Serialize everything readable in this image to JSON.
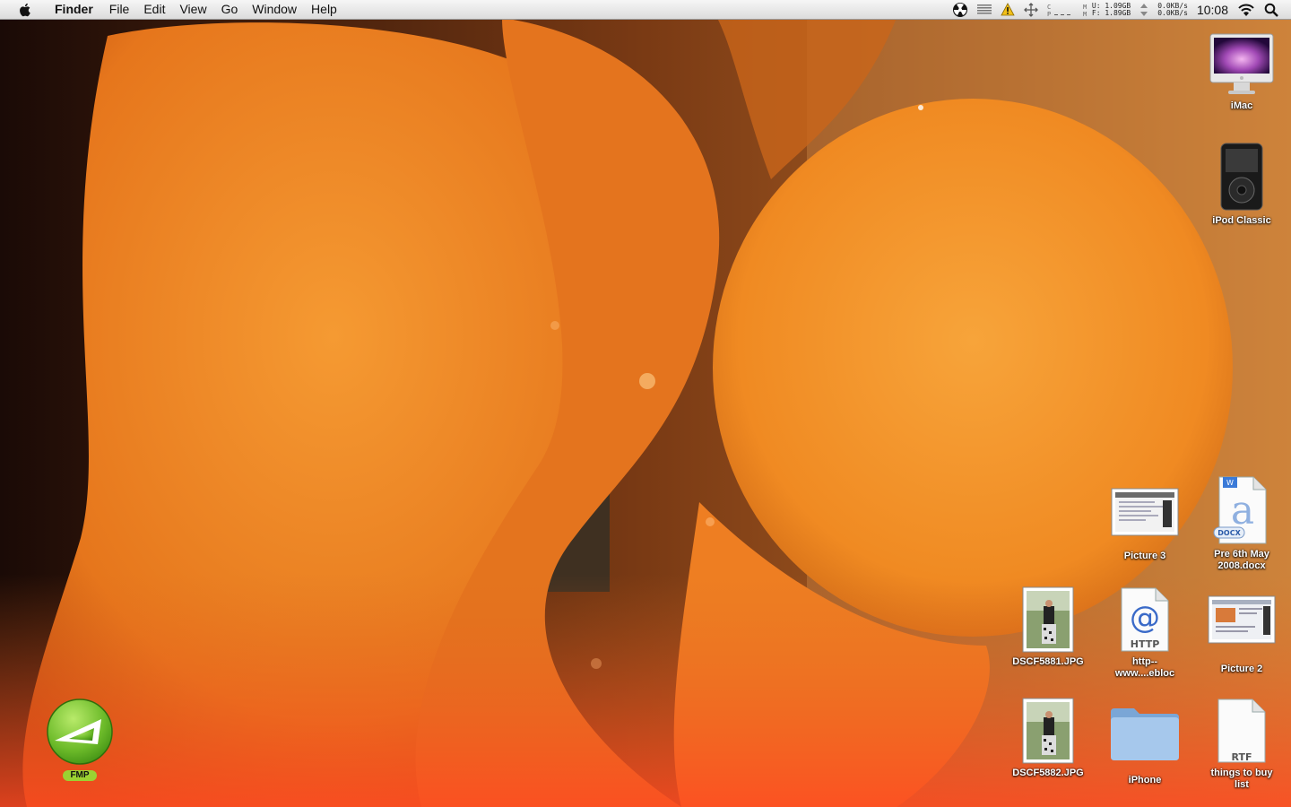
{
  "menubar": {
    "app_name": "Finder",
    "menus": [
      "File",
      "Edit",
      "View",
      "Go",
      "Window",
      "Help"
    ],
    "memory": {
      "used": "U: 1.09GB",
      "free": "F: 1.89GB"
    },
    "network": {
      "up": "0.0KB/s",
      "down": "0.0KB/s"
    },
    "clock": "10:08",
    "icons": [
      "apple-icon",
      "radiation-icon",
      "list-icon",
      "warning-icon",
      "move-icon",
      "cpu-meter-icon",
      "memory-meter-icon",
      "wifi-icon",
      "spotlight-icon"
    ]
  },
  "desktop": {
    "icons": [
      {
        "label": "iMac",
        "icon": "imac-icon"
      },
      {
        "label": "iPod Classic",
        "icon": "ipod-icon"
      },
      {
        "label": "Picture 3",
        "icon": "screenshot-icon"
      },
      {
        "label": "Pre 6th May 2008.docx",
        "icon": "docx-icon",
        "badge": "DOCX"
      },
      {
        "label": "DSCF5881.JPG",
        "icon": "photo-icon"
      },
      {
        "label": "http--www....ebloc",
        "icon": "webloc-icon",
        "badge": "HTTP"
      },
      {
        "label": "Picture 2",
        "icon": "screenshot-icon"
      },
      {
        "label": "DSCF5882.JPG",
        "icon": "photo-icon"
      },
      {
        "label": "iPhone",
        "icon": "folder-icon"
      },
      {
        "label": "things to buy list",
        "icon": "rtf-icon",
        "badge": "RTF"
      },
      {
        "label": "FMP",
        "icon": "fmp-icon"
      }
    ]
  },
  "colors": {
    "wallpaper_dark": "#2a1208",
    "lava_orange": "#f08a22",
    "lava_light": "#f7a640",
    "folder_blue": "#8fb8e0",
    "fmp_green": "#6dbb2a"
  }
}
